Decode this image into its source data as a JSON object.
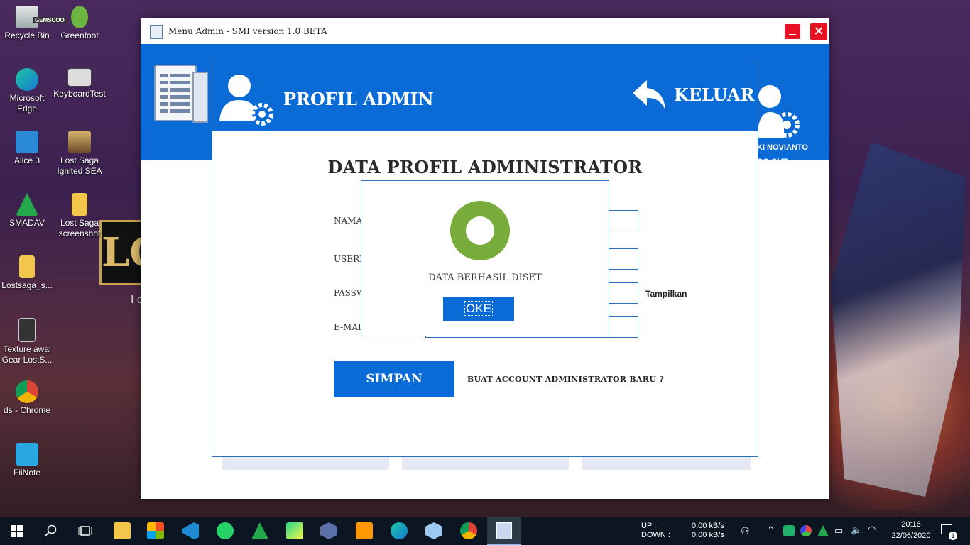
{
  "desktop": {
    "icons": [
      {
        "label": "Recycle Bin"
      },
      {
        "label": "Greenfoot"
      },
      {
        "label": "Microsoft Edge"
      },
      {
        "label": "KeyboardTest"
      },
      {
        "label": "Alice 3"
      },
      {
        "label": "Lost Saga Ignited SEA"
      },
      {
        "label": "SMADAV"
      },
      {
        "label": "Lost Saga screenshot"
      },
      {
        "label": "Lostsaga_s..."
      },
      {
        "label": "Texture awal Gear LostS..."
      },
      {
        "label": "ds - Chrome"
      },
      {
        "label": "FiiNote"
      }
    ],
    "gemscool": "GEMSCOO",
    "bg_logo": "LO",
    "bg_logo_sub": "I c"
  },
  "window": {
    "title": "Menu Admin - SMI version 1.0 BETA",
    "user_name": "KI NOVIANTO",
    "logout": "OG OUT"
  },
  "panel": {
    "header_title": "PROFIL ADMIN",
    "exit_label": "KELUAR",
    "section_title": "DATA PROFIL ADMINISTRATOR",
    "labels": {
      "nama": "NAMA",
      "username": "USERN",
      "password": "PASSW",
      "email": "E-MAIL"
    },
    "show_password": "Tampilkan",
    "save_button": "SIMPAN",
    "new_account_link": "BUAT ACCOUNT ADMINISTRATOR BARU ?"
  },
  "dialog": {
    "message": "DATA BERHASIL DISET",
    "ok_button": "OKE"
  },
  "taskbar": {
    "up_label": "UP :",
    "down_label": "DOWN :",
    "up_speed": "0.00 kB/s",
    "down_speed": "0.00 kB/s",
    "time": "20:16",
    "date": "22/06/2020",
    "notifications": "1"
  },
  "colors": {
    "accent": "#0a6ad6",
    "success_ring": "#78ad3c",
    "close_red": "#e81123"
  }
}
